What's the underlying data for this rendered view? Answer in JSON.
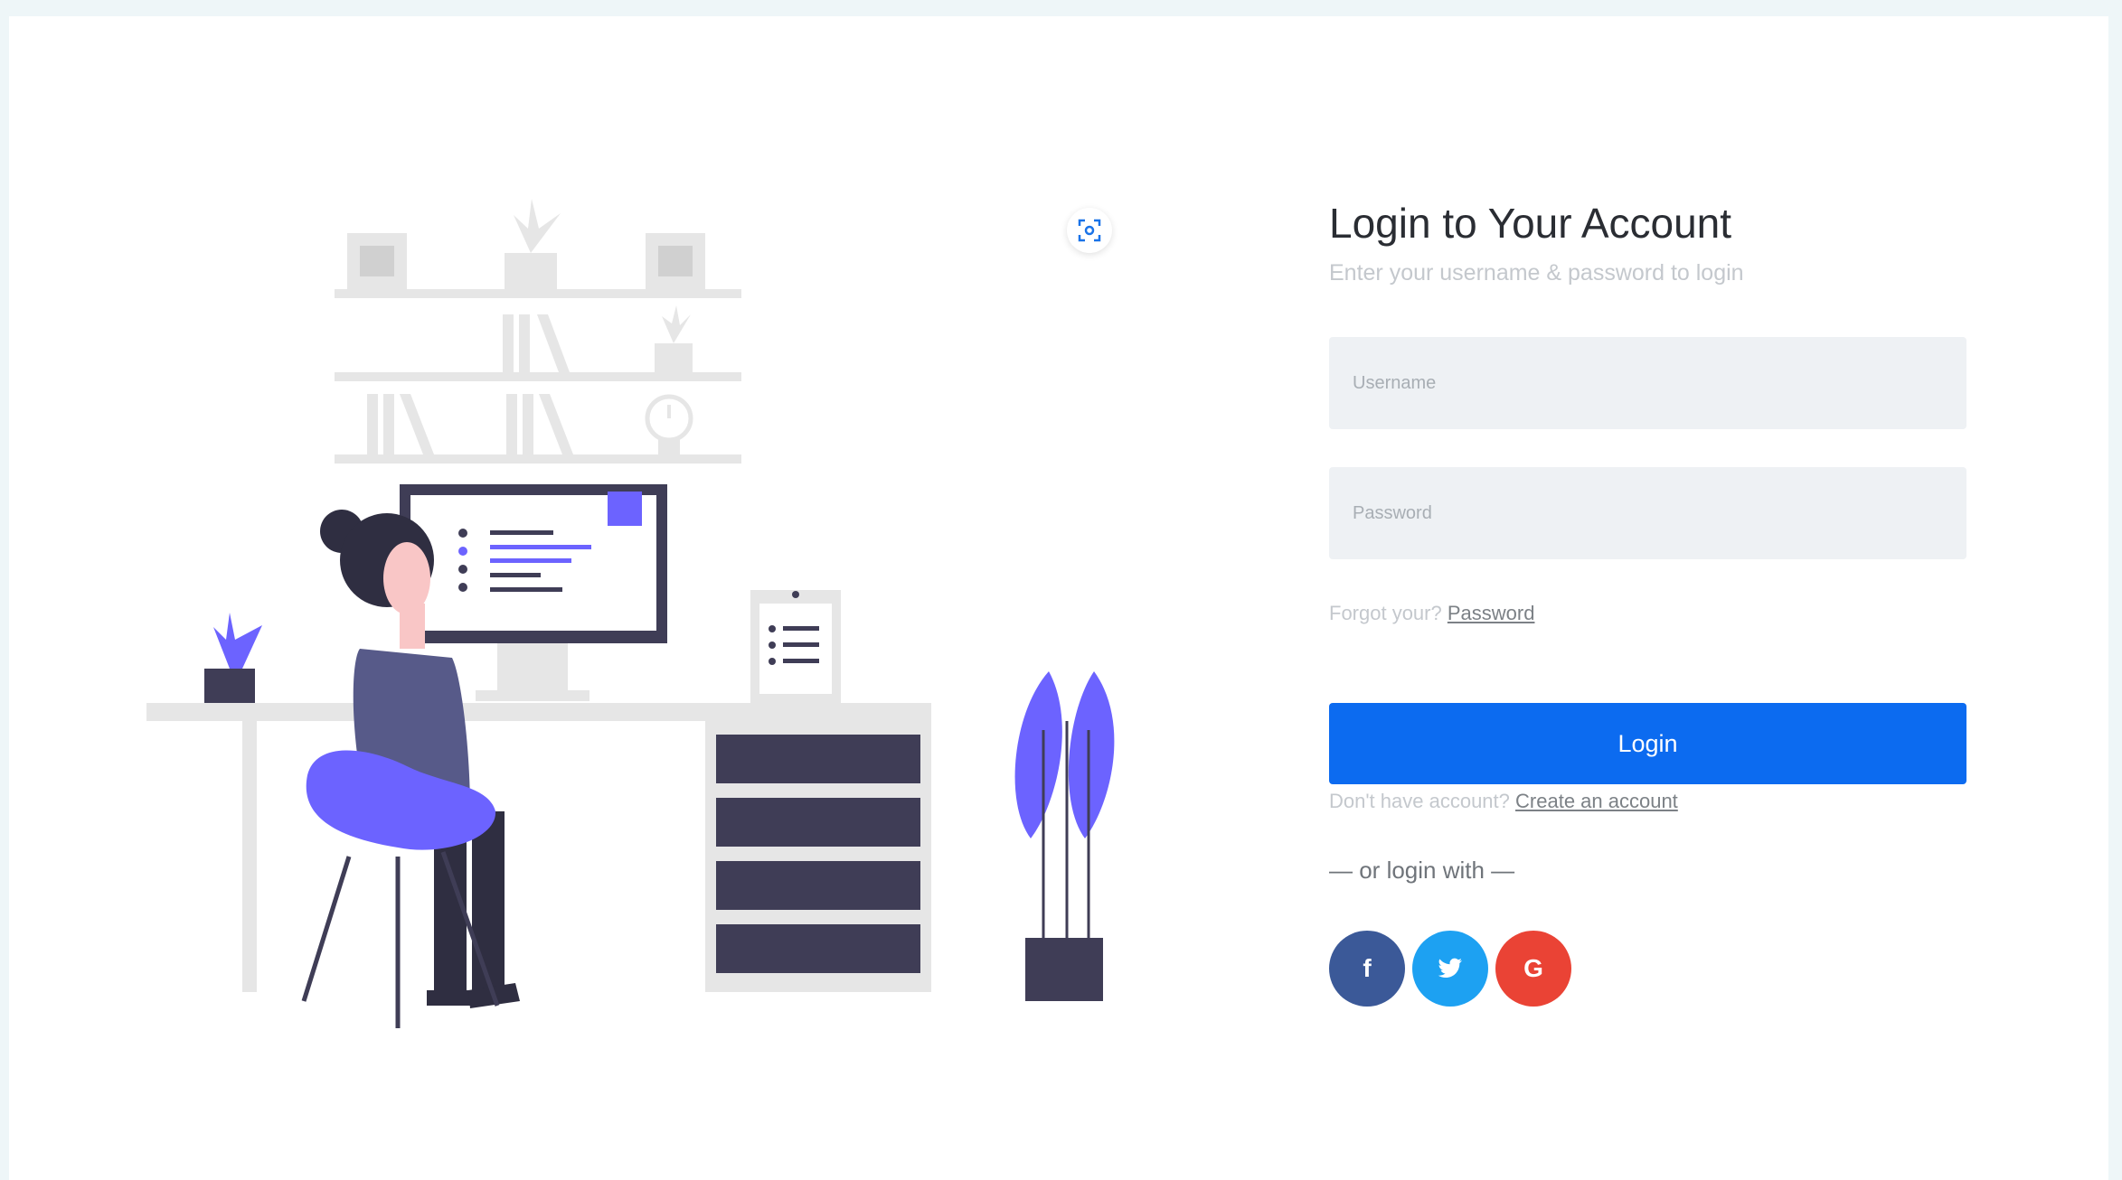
{
  "login": {
    "title": "Login to Your Account",
    "subtitle": "Enter your username & password to login",
    "username_placeholder": "Username",
    "password_placeholder": "Password",
    "forgot_prefix": "Forgot your?",
    "forgot_link": "Password",
    "login_label": "Login",
    "signup_prefix": "Don't have account?",
    "signup_link": "Create an account",
    "divider": "— or login with —"
  },
  "socials": [
    {
      "name": "facebook",
      "glyph": "f",
      "color": "#3b5998"
    },
    {
      "name": "twitter",
      "glyph": "t",
      "color": "#1da1f2"
    },
    {
      "name": "google",
      "glyph": "G",
      "color": "#ea4335"
    }
  ],
  "colors": {
    "primary": "#0c6bf0",
    "accent": "#6c63ff",
    "dark": "#3f3d56",
    "shelf": "#e6e6e6"
  }
}
